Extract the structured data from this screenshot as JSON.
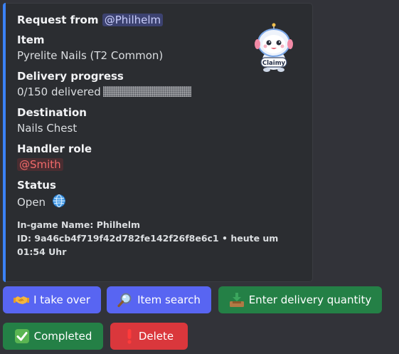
{
  "embed": {
    "accent": "#3b82f6",
    "title_prefix": "Request from",
    "title_mention": "@Philhelm",
    "fields": {
      "item": {
        "name": "Item",
        "value": "Pyrelite Nails (T2 Common)"
      },
      "progress": {
        "name": "Delivery progress",
        "value": "0/150 delivered",
        "fraction": 0.0
      },
      "destination": {
        "name": "Destination",
        "value": "Nails Chest"
      },
      "handler": {
        "name": "Handler role",
        "value": "@Smith"
      },
      "status": {
        "name": "Status",
        "value": "Open",
        "icon": "globe-icon"
      }
    },
    "footer_line1": "In-game Name: Philhelm",
    "footer_line2": "ID: 9a46cb4f719f42d782fe142f26f8e6c1 • heute um 01:54 Uhr",
    "thumbnail": {
      "icon": "claimy-mascot-icon",
      "label": "Claimy"
    }
  },
  "buttons": {
    "take_over": {
      "label": "I take over",
      "icon": "handshake-icon",
      "color": "#5865f2"
    },
    "item_search": {
      "label": "Item search",
      "icon": "magnifier-icon",
      "color": "#5865f2"
    },
    "enter_quantity": {
      "label": "Enter delivery quantity",
      "icon": "inbox-tray-icon",
      "color": "#248046"
    },
    "completed": {
      "label": "Completed",
      "icon": "check-mark-icon",
      "color": "#248046"
    },
    "delete": {
      "label": "Delete",
      "icon": "exclamation-icon",
      "color": "#da373c"
    }
  }
}
